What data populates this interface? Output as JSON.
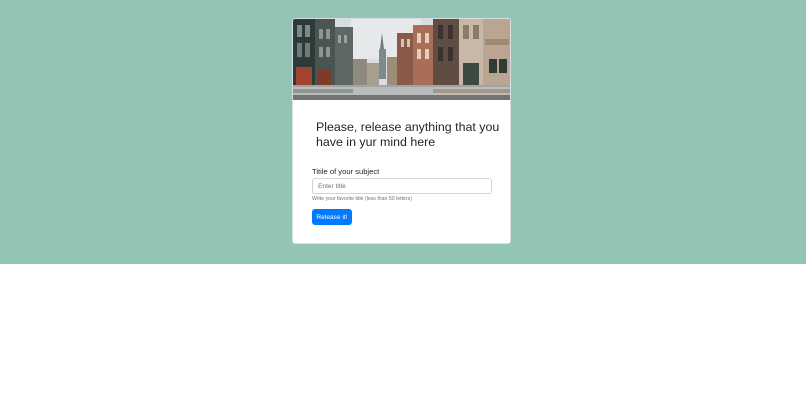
{
  "colors": {
    "band_background": "#93c5b6",
    "button_primary": "#007bff"
  },
  "card": {
    "image_description_icon": "street-photo",
    "heading": "Please, release anything that you have in yur mind here"
  },
  "form": {
    "title_label": "Titile of your subject",
    "title_placeholder": "Enter title",
    "title_value": "",
    "help_text": "Write your favorite title (less than 50 letters)",
    "submit_label": "Release it!"
  }
}
